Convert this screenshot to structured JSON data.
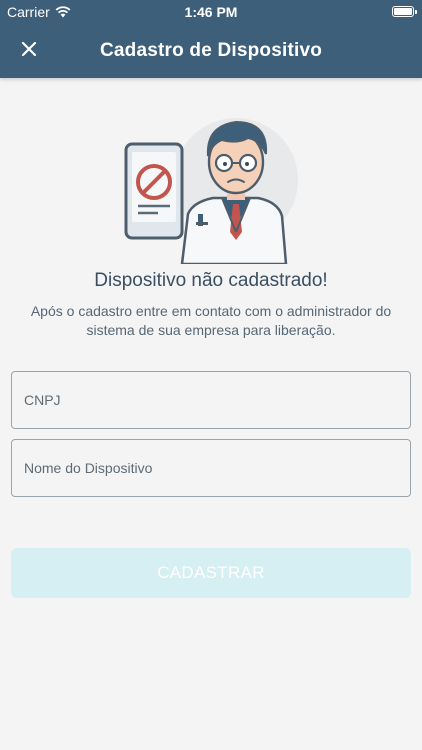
{
  "status_bar": {
    "carrier": "Carrier",
    "time": "1:46 PM"
  },
  "navbar": {
    "title": "Cadastro de Dispositivo",
    "close_icon": "close-icon"
  },
  "content": {
    "heading": "Dispositivo não cadastrado!",
    "message": "Após o cadastro entre em contato com o administrador do sistema de sua empresa para liberação."
  },
  "form": {
    "cnpj_placeholder": "CNPJ",
    "device_name_placeholder": "Nome do Dispositivo",
    "submit_label": "CADASTRAR"
  },
  "colors": {
    "header": "#3e5f79",
    "background": "#f4f4f4",
    "button_disabled": "#d6eff2",
    "text_dark": "#3a4f62"
  }
}
